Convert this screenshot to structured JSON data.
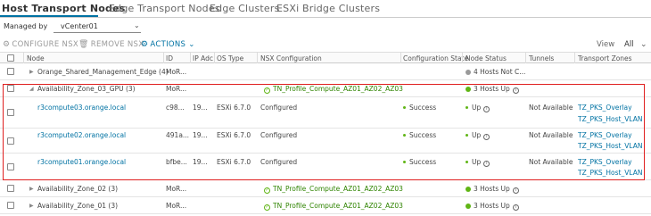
{
  "tabs": [
    {
      "label": "Host Transport Nodes"
    },
    {
      "label": "Edge Transport Nodes"
    },
    {
      "label": "Edge Clusters"
    },
    {
      "label": "ESXi Bridge Clusters"
    }
  ],
  "managed_by": {
    "label": "Managed by",
    "value": "vCenter01"
  },
  "toolbar": {
    "configure_label": "CONFIGURE NSX",
    "remove_label": "REMOVE NSX",
    "actions_label": "ACTIONS",
    "view_label": "View",
    "view_value": "All"
  },
  "columns": {
    "node": "Node",
    "id": "ID",
    "ip": "IP Adc",
    "os": "OS Type",
    "nsx": "NSX Configuration",
    "config_state": "Configuration State",
    "node_status": "Node Status",
    "tunnels": "Tunnels",
    "tz": "Transport Zones"
  },
  "rows": [
    {
      "node": "Orange_Shared_Management_Edge (4)",
      "id": "MoR...",
      "nsx": "",
      "status": "4 Hosts Not C..."
    },
    {
      "node": "Availability_Zone_03_GPU (3)",
      "id": "MoR...",
      "nsx": "TN_Profile_Compute_AZ01_AZ02_AZ03",
      "status": "3 Hosts Up"
    },
    {
      "node": "r3compute03.orange.local",
      "id": "c98...",
      "ip": "19...",
      "os": "ESXi 6.7.0",
      "nsx": "Configured",
      "state": "Success",
      "status": "Up",
      "tunnels": "Not Available",
      "tz1": "TZ_PKS_Overlay",
      "tz2": "TZ_PKS_Host_VLAN"
    },
    {
      "node": "r3compute02.orange.local",
      "id": "491a...",
      "ip": "19...",
      "os": "ESXi 6.7.0",
      "nsx": "Configured",
      "state": "Success",
      "status": "Up",
      "tunnels": "Not Available",
      "tz1": "TZ_PKS_Overlay",
      "tz2": "TZ_PKS_Host_VLAN"
    },
    {
      "node": "r3compute01.orange.local",
      "id": "bfbe...",
      "ip": "19...",
      "os": "ESXi 6.7.0",
      "nsx": "Configured",
      "state": "Success",
      "status": "Up",
      "tunnels": "Not Available",
      "tz1": "TZ_PKS_Overlay",
      "tz2": "TZ_PKS_Host_VLAN"
    },
    {
      "node": "Availability_Zone_02 (3)",
      "id": "MoR...",
      "nsx": "TN_Profile_Compute_AZ01_AZ02_AZ03",
      "status": "3 Hosts Up"
    },
    {
      "node": "Availability_Zone_01 (3)",
      "id": "MoR...",
      "nsx": "TN_Profile_Compute_AZ01_AZ02_AZ03",
      "status": "3 Hosts Up"
    }
  ],
  "colors": {
    "accent": "#0072a3",
    "success": "#60b515",
    "highlight": "#e02020"
  }
}
